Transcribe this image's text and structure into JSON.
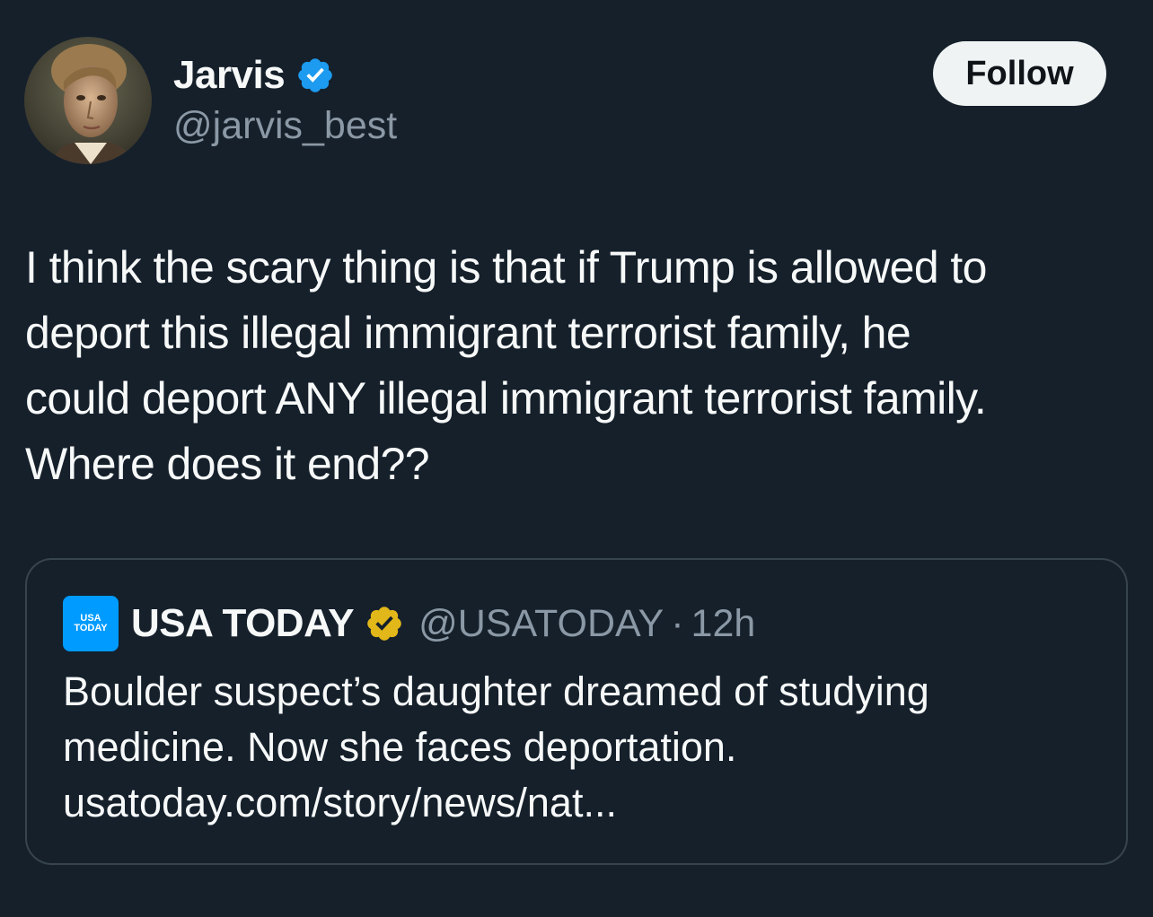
{
  "author": {
    "display_name": "Jarvis",
    "handle": "@jarvis_best",
    "verified": true,
    "avatar": "portrait-avatar"
  },
  "follow_button": {
    "label": "Follow"
  },
  "tweet": {
    "lines": [
      "I think the scary thing is that if Trump is allowed to",
      "deport this illegal immigrant terrorist family, he",
      "could deport ANY illegal immigrant terrorist family.",
      "Where does it end??"
    ]
  },
  "quoted_tweet": {
    "logo": {
      "line1": "USA",
      "line2": "TODAY",
      "color": "#009bff"
    },
    "display_name": "USA TODAY",
    "verified_gold": true,
    "handle": "@USATODAY",
    "separator": "·",
    "time": "12h",
    "lines": [
      "Boulder suspect’s daughter dreamed of studying",
      "medicine. Now she faces deportation.",
      "usatoday.com/story/news/nat..."
    ]
  },
  "colors": {
    "background": "#15202b",
    "text_primary": "#f7f9f9",
    "text_secondary": "#8b98a5",
    "border": "#38444d",
    "verified_blue": "#1d9bf0",
    "verified_gold": "#e2b719",
    "follow_button_bg": "#eff3f4"
  }
}
